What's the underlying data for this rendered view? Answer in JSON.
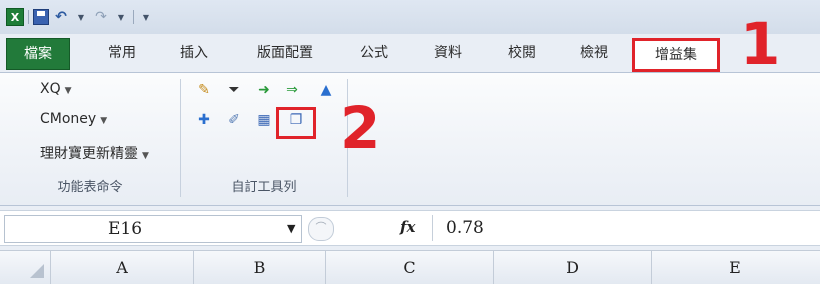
{
  "quick_access": {
    "app_icon": "excel-icon",
    "save_icon": "save-icon",
    "undo_icon": "undo-icon",
    "redo_icon": "redo-icon"
  },
  "tabs": [
    {
      "id": "file",
      "label": "檔案"
    },
    {
      "id": "home",
      "label": "常用"
    },
    {
      "id": "insert",
      "label": "插入"
    },
    {
      "id": "layout",
      "label": "版面配置"
    },
    {
      "id": "formulas",
      "label": "公式"
    },
    {
      "id": "data",
      "label": "資料"
    },
    {
      "id": "review",
      "label": "校閱"
    },
    {
      "id": "view",
      "label": "檢視"
    },
    {
      "id": "addins",
      "label": "增益集"
    }
  ],
  "annotations": {
    "marker_1": "1",
    "marker_2": "2",
    "accent": "#e0232a"
  },
  "ribbon": {
    "menu_commands": {
      "items": [
        {
          "label": "XQ"
        },
        {
          "label": "CMoney"
        },
        {
          "label": "理財寶更新精靈"
        }
      ],
      "group_label": "功能表命令"
    },
    "custom_toolbars": {
      "group_label": "自訂工具列",
      "icons": [
        "new-note-icon",
        "filter-icon",
        "arrow-right-icon",
        "double-arrow-right-icon",
        "arrow-up-icon",
        "plus-icon",
        "edit-icon",
        "table-icon",
        "copy-window-icon"
      ]
    }
  },
  "formula_bar": {
    "name_box": "E16",
    "value": "0.78",
    "fx": "fx"
  },
  "columns": [
    "A",
    "B",
    "C",
    "D",
    "E"
  ],
  "colors": {
    "file_tab": "#227a3a",
    "highlight": "#e0232a"
  }
}
